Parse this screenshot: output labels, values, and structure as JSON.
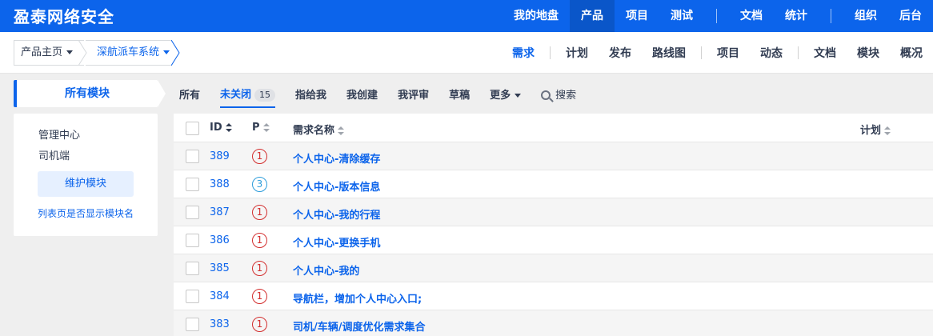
{
  "app": {
    "title": "盈泰网络安全"
  },
  "topnav": [
    {
      "label": "我的地盘",
      "active": false
    },
    {
      "label": "产品",
      "active": true
    },
    {
      "label": "项目",
      "active": false
    },
    {
      "label": "测试",
      "active": false
    },
    {
      "sep": true
    },
    {
      "label": "文档",
      "active": false
    },
    {
      "label": "统计",
      "active": false
    },
    {
      "sep": true
    },
    {
      "label": "组织",
      "active": false
    },
    {
      "label": "后台",
      "active": false
    }
  ],
  "breadcrumb": {
    "home": "产品主页",
    "product": "深航派车系统"
  },
  "subnav": [
    {
      "label": "需求",
      "active": true
    },
    {
      "sep": true
    },
    {
      "label": "计划"
    },
    {
      "label": "发布"
    },
    {
      "label": "路线图"
    },
    {
      "sep": true
    },
    {
      "label": "项目"
    },
    {
      "label": "动态"
    },
    {
      "sep": true
    },
    {
      "label": "文档"
    },
    {
      "label": "模块"
    },
    {
      "label": "概况"
    }
  ],
  "sidebar": {
    "title": "所有模块",
    "modules": [
      "管理中心",
      "司机端"
    ],
    "maintain_button": "维护模块",
    "show_module_link": "列表页是否显示模块名"
  },
  "filters": {
    "all": "所有",
    "unclosed": "未关闭",
    "unclosed_count": "15",
    "assigned": "指给我",
    "created": "我创建",
    "reviewed": "我评审",
    "draft": "草稿",
    "more": "更多",
    "search": "搜索"
  },
  "table": {
    "columns": {
      "id": "ID",
      "priority": "P",
      "name": "需求名称",
      "plan": "计划"
    },
    "rows": [
      {
        "id": "389",
        "pri": "1",
        "name": "个人中心-清除缓存"
      },
      {
        "id": "388",
        "pri": "3",
        "name": "个人中心-版本信息"
      },
      {
        "id": "387",
        "pri": "1",
        "name": "个人中心-我的行程"
      },
      {
        "id": "386",
        "pri": "1",
        "name": "个人中心-更换手机"
      },
      {
        "id": "385",
        "pri": "1",
        "name": "个人中心-我的"
      },
      {
        "id": "384",
        "pri": "1",
        "name": "导航栏，增加个人中心入口;"
      },
      {
        "id": "383",
        "pri": "1",
        "name": "司机/车辆/调度优化需求集合"
      }
    ]
  },
  "colors": {
    "primary": "#0c64eb",
    "pri1": "#d32f2f",
    "pri3": "#2d9ddb"
  }
}
